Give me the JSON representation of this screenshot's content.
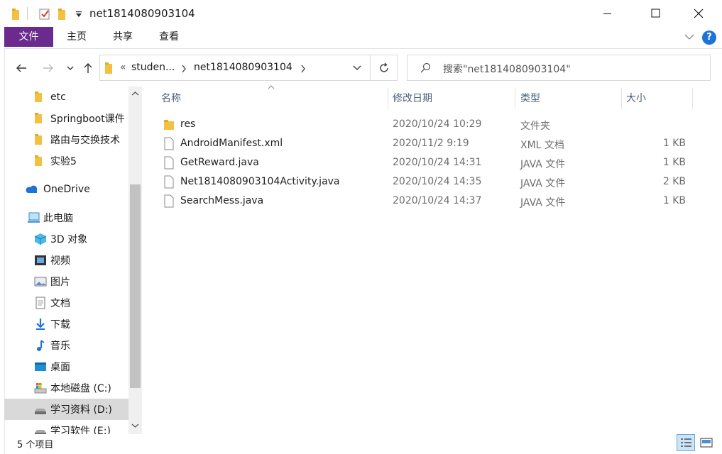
{
  "window": {
    "title": "net1814080903104",
    "controls": {
      "minimize": "minimize",
      "maximize": "maximize",
      "close": "close"
    }
  },
  "ribbon": {
    "tabs": [
      "文件",
      "主页",
      "共享",
      "查看"
    ],
    "help_label": "?"
  },
  "address": {
    "prefix": "«",
    "segments": [
      "studen...",
      "net1814080903104"
    ]
  },
  "search": {
    "placeholder": "搜索\"net1814080903104\""
  },
  "nav": {
    "items": [
      {
        "label": "etc",
        "icon": "folder-icon"
      },
      {
        "label": "Springboot课件",
        "icon": "folder-icon"
      },
      {
        "label": "路由与交换技术",
        "icon": "folder-icon"
      },
      {
        "label": "实验5",
        "icon": "folder-icon"
      },
      {
        "label": "OneDrive",
        "icon": "onedrive-icon"
      },
      {
        "label": "此电脑",
        "icon": "computer-icon"
      },
      {
        "label": "3D 对象",
        "icon": "3d-objects-icon"
      },
      {
        "label": "视频",
        "icon": "video-icon"
      },
      {
        "label": "图片",
        "icon": "pictures-icon"
      },
      {
        "label": "文档",
        "icon": "documents-icon"
      },
      {
        "label": "下载",
        "icon": "download-icon"
      },
      {
        "label": "音乐",
        "icon": "music-icon"
      },
      {
        "label": "桌面",
        "icon": "desktop-icon"
      },
      {
        "label": "本地磁盘 (C:)",
        "icon": "drive-c-icon"
      },
      {
        "label": "学习资料 (D:)",
        "icon": "drive-icon",
        "selected": true
      },
      {
        "label": "学习软件 (E:)",
        "icon": "drive-icon"
      }
    ]
  },
  "columns": {
    "name": "名称",
    "date": "修改日期",
    "type": "类型",
    "size": "大小"
  },
  "files": [
    {
      "name": "res",
      "date": "2020/10/24 10:29",
      "type": "文件夹",
      "size": "",
      "kind": "folder"
    },
    {
      "name": "AndroidManifest.xml",
      "date": "2020/11/2 9:19",
      "type": "XML 文档",
      "size": "1 KB",
      "kind": "file"
    },
    {
      "name": "GetReward.java",
      "date": "2020/10/24 14:31",
      "type": "JAVA 文件",
      "size": "1 KB",
      "kind": "file"
    },
    {
      "name": "Net1814080903104Activity.java",
      "date": "2020/10/24 14:35",
      "type": "JAVA 文件",
      "size": "2 KB",
      "kind": "file"
    },
    {
      "name": "SearchMess.java",
      "date": "2020/10/24 14:37",
      "type": "JAVA 文件",
      "size": "1 KB",
      "kind": "file"
    }
  ],
  "status": {
    "item_count": "5 个项目"
  },
  "colors": {
    "file_tab": "#6a2a8e",
    "folder": "#f3c042",
    "help": "#1e73d6",
    "selected": "#d9d9d9"
  }
}
